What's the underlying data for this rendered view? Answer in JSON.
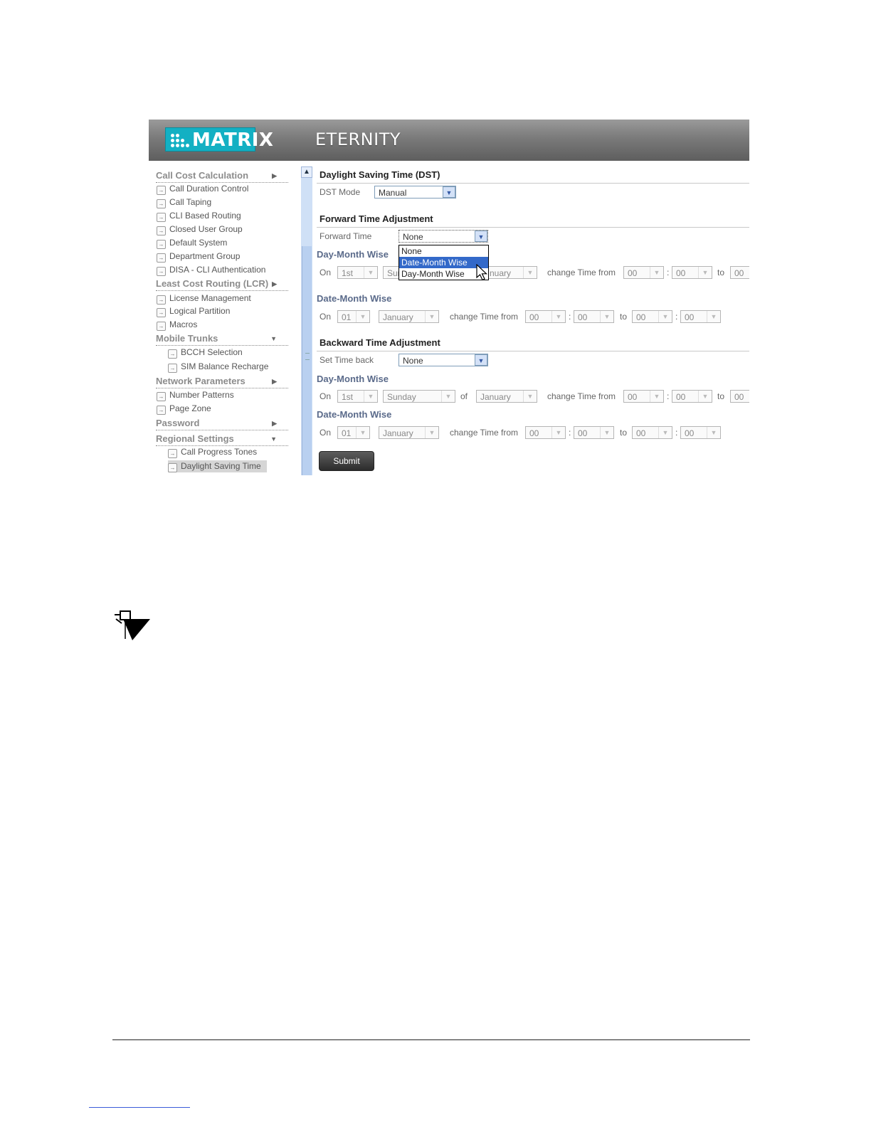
{
  "header": {
    "brand": "MATRIX",
    "app_title": "ETERNITY"
  },
  "sidebar": {
    "groups": [
      {
        "label": "Call Cost Calculation"
      },
      {
        "label": "Least Cost Routing (LCR)"
      },
      {
        "label": "Mobile Trunks"
      },
      {
        "label": "Network Parameters"
      },
      {
        "label": "Password"
      },
      {
        "label": "Regional Settings"
      }
    ],
    "items": [
      {
        "label": "Call Duration Control"
      },
      {
        "label": "Call Taping"
      },
      {
        "label": "CLI Based Routing"
      },
      {
        "label": "Closed User Group"
      },
      {
        "label": "Default System"
      },
      {
        "label": "Department Group"
      },
      {
        "label": "DISA - CLI Authentication"
      },
      {
        "label": "License Management"
      },
      {
        "label": "Logical Partition"
      },
      {
        "label": "Macros"
      },
      {
        "label": "BCCH Selection"
      },
      {
        "label": "SIM Balance Recharge"
      },
      {
        "label": "Number Patterns"
      },
      {
        "label": "Page Zone"
      },
      {
        "label": "Call Progress Tones"
      },
      {
        "label": "Daylight Saving Time"
      }
    ]
  },
  "dst": {
    "title": "Daylight Saving Time (DST)",
    "mode_label": "DST Mode",
    "mode_value": "Manual"
  },
  "forward": {
    "title": "Forward Time Adjustment",
    "label": "Forward Time",
    "value": "None",
    "dropdown_options": [
      "None",
      "Date-Month Wise",
      "Day-Month Wise"
    ],
    "day_month": {
      "title": "Day-Month Wise",
      "on": "On",
      "ordinal": "1st",
      "day_partial": "Sun",
      "month_partial": "nuary",
      "change_from": "change Time from",
      "hour": "00",
      "colon": ":",
      "minute": "00",
      "to": "to",
      "to_hour": "00"
    },
    "date_month": {
      "title": "Date-Month Wise",
      "on": "On",
      "date": "01",
      "month": "January",
      "change_from": "change Time from",
      "hour": "00",
      "colon": ":",
      "minute": "00",
      "to": "to",
      "to_hour": "00",
      "to_minute": "00"
    }
  },
  "backward": {
    "title": "Backward Time Adjustment",
    "label": "Set Time back",
    "value": "None",
    "day_month": {
      "title": "Day-Month Wise",
      "on": "On",
      "ordinal": "1st",
      "day": "Sunday",
      "of": "of",
      "month": "January",
      "change_from": "change Time from",
      "hour": "00",
      "colon": ":",
      "minute": "00",
      "to": "to",
      "to_hour": "00"
    },
    "date_month": {
      "title": "Date-Month Wise",
      "on": "On",
      "date": "01",
      "month": "January",
      "change_from": "change Time from",
      "hour": "00",
      "colon": ":",
      "minute": "00",
      "to": "to",
      "to_hour": "00",
      "to_minute": "00"
    }
  },
  "submit_label": "Submit",
  "icons": {
    "nav": "arrow-box-icon",
    "note": "note-pin-icon"
  }
}
